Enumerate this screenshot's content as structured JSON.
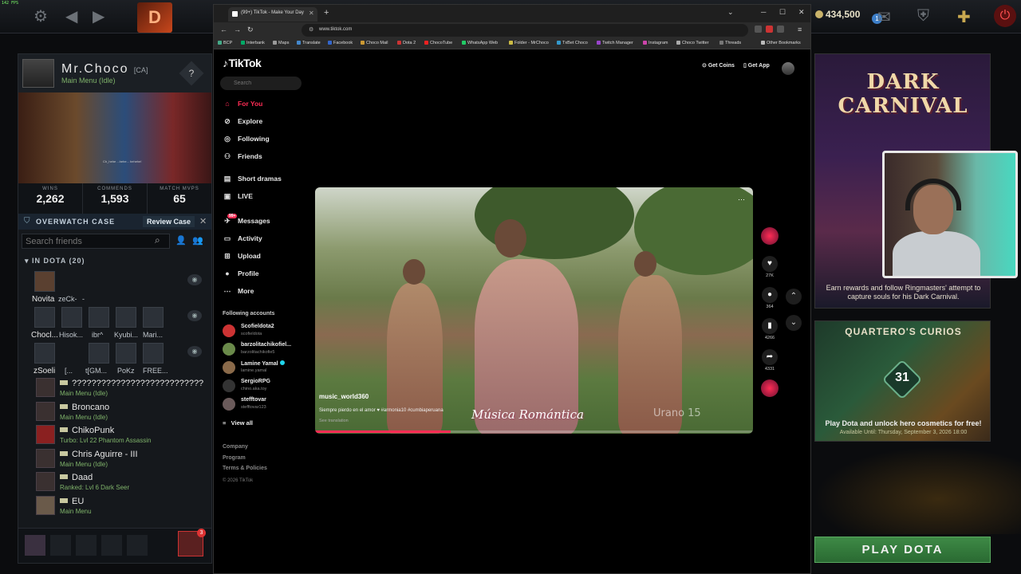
{
  "overlay": {
    "fps": "142 FPS"
  },
  "dota_top": {
    "shards": "434,500",
    "notifications": "1"
  },
  "profile": {
    "name": "Mr.Choco",
    "tag": "[CA]",
    "status": "Main Menu (Idle)",
    "help": "?",
    "hero_caption": "Ch_hehe ...hehe... hehehe!",
    "stats": [
      {
        "label": "WINS",
        "value": "2,262"
      },
      {
        "label": "COMMENDS",
        "value": "1,593"
      },
      {
        "label": "MATCH MVPS",
        "value": "65"
      }
    ]
  },
  "overwatch": {
    "label": "OVERWATCH CASE",
    "button": "Review Case"
  },
  "friends": {
    "search_placeholder": "Search friends",
    "in_dota_header": "IN DOTA (20)",
    "grid_rows": [
      [
        "Novita",
        "zeCk-",
        "-"
      ],
      [
        "Chocl...",
        "Hisok...",
        "ibr^",
        "Kyubi...",
        "Mari..."
      ],
      [
        "zSoeli",
        "[...",
        "t[GM...",
        "PoKz",
        "FREE..."
      ]
    ],
    "list": [
      {
        "name": "???????????????????????????",
        "status": "Main Menu (Idle)"
      },
      {
        "name": "Broncano",
        "status": "Main Menu (Idle)"
      },
      {
        "name": "ChikoPunk",
        "status": "Turbo: Lvl 22 Phantom Assassin"
      },
      {
        "name": "Chris Aguirre - III",
        "status": "Main Menu (Idle)"
      },
      {
        "name": "Daad",
        "status": "Ranked: Lvl 6 Dark Seer"
      },
      {
        "name": "EU",
        "status": "Main Menu"
      }
    ],
    "party_chat_badge": "3"
  },
  "browser": {
    "tab_title": "(99+) TikTok - Make Your Day",
    "url": "www.tiktok.com",
    "bookmarks": [
      "BCP",
      "Interbank",
      "Maps",
      "Translate",
      "Facebook",
      "Choco Mail",
      "Dota 2",
      "ChocoTube",
      "WhatsApp Web",
      "Folder - MrChoco",
      "TxBet Choco",
      "Twitch Manager",
      "Instagram",
      "Choco Twitter",
      "Threads",
      "Other Bookmarks"
    ]
  },
  "tiktok": {
    "logo": "TikTok",
    "search_placeholder": "Search",
    "nav": [
      {
        "label": "For You",
        "icon": "home-icon"
      },
      {
        "label": "Explore",
        "icon": "compass-icon"
      },
      {
        "label": "Following",
        "icon": "following-icon"
      },
      {
        "label": "Friends",
        "icon": "friends-icon"
      },
      {
        "label": "Short dramas",
        "icon": "drama-icon"
      },
      {
        "label": "LIVE",
        "icon": "live-icon"
      },
      {
        "label": "Messages",
        "icon": "messages-icon"
      },
      {
        "label": "Activity",
        "icon": "activity-icon"
      },
      {
        "label": "Upload",
        "icon": "upload-icon"
      },
      {
        "label": "Profile",
        "icon": "profile-icon"
      },
      {
        "label": "More",
        "icon": "more-icon"
      }
    ],
    "messages_badge": "99+",
    "following_title": "Following accounts",
    "accounts": [
      {
        "name": "Scofieldota2",
        "handle": "scofieldota"
      },
      {
        "name": "barzolitachikofiel...",
        "handle": "barzolitachikofie5"
      },
      {
        "name": "Lamine Yamal",
        "handle": "lamine.yamal",
        "verified": true
      },
      {
        "name": "SergioRPG",
        "handle": "chino.aka.toy"
      },
      {
        "name": "stefftovar",
        "handle": "stefftovar123"
      }
    ],
    "view_all": "View all",
    "footer": [
      "Company",
      "Program",
      "Terms & Policies"
    ],
    "copyright": "© 2026 TikTok",
    "get_coins": "Get Coins",
    "get_app": "Get App",
    "video": {
      "author": "music_world360",
      "caption": "Siempre pierdo en el amor ♥ #armonia10 #cumbiaperuana",
      "translate": "See translation",
      "watermark": "Música Romántica",
      "watermark2": "Urano 15",
      "progress": 0.31
    },
    "actions": [
      {
        "icon": "heart-icon",
        "count": "27K"
      },
      {
        "icon": "comment-icon",
        "count": "364"
      },
      {
        "icon": "bookmark-icon",
        "count": "4266"
      },
      {
        "icon": "share-icon",
        "count": "4331"
      }
    ]
  },
  "right_panel": {
    "event_title": "DARK CARNIVAL",
    "event_desc": "Earn rewards and follow Ringmasters' attempt to capture souls for his Dark Carnival.",
    "curios_title": "QUARTERO'S CURIOS",
    "curios_number": "31",
    "curios_desc": "Play Dota and unlock hero cosmetics for free!",
    "curios_until": "Available Until:  Thursday, September 3, 2026 18:00",
    "play_button": "PLAY DOTA"
  }
}
